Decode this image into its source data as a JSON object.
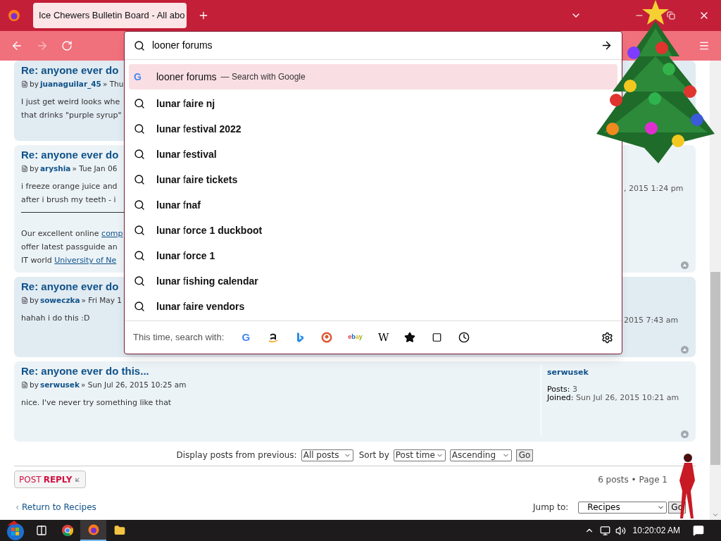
{
  "browser": {
    "tabs": [
      {
        "title": "Ice Chewers Bulletin Board - All abo",
        "selected": true
      }
    ],
    "address": {
      "value": "looner forums"
    },
    "suggestions": [
      {
        "kind": "engine",
        "glyph": "G",
        "text": "looner forums",
        "hint": "— Search with Google",
        "selected": true
      },
      {
        "kind": "search",
        "text": "**lunar** f**aire nj**",
        "selected": false
      },
      {
        "kind": "search",
        "text": "**lunar** f**estival 2022**",
        "selected": false
      },
      {
        "kind": "search",
        "text": "**lunar** f**estival**",
        "selected": false
      },
      {
        "kind": "search",
        "text": "**lunar** f**aire tickets**",
        "selected": false
      },
      {
        "kind": "search",
        "text": "**lunar** f**naf**",
        "selected": false
      },
      {
        "kind": "search",
        "text": "**lunar** f**orce 1 duckboot**",
        "selected": false
      },
      {
        "kind": "search",
        "text": "**lunar** f**orce 1**",
        "selected": false
      },
      {
        "kind": "search",
        "text": "**lunar** f**ishing calendar**",
        "selected": false
      },
      {
        "kind": "search",
        "text": "**lunar** f**aire vendors**",
        "selected": false
      }
    ],
    "search_with": {
      "label": "This time, search with:",
      "engines": [
        {
          "kind": "google",
          "glyph": "G"
        },
        {
          "kind": "amazon"
        },
        {
          "kind": "bing"
        },
        {
          "kind": "duckduckgo"
        },
        {
          "kind": "ebay"
        },
        {
          "kind": "wikipedia",
          "glyph": "W"
        },
        {
          "kind": "bookmarks"
        },
        {
          "kind": "tabs"
        },
        {
          "kind": "history"
        }
      ]
    }
  },
  "posts": [
    {
      "title": "Re: anyone ever do",
      "by": "by",
      "author": "juanaguilar_45",
      "meta": "» Thu",
      "body": [
        "I just get weird looks whe",
        "that drinks \"purple syrup\""
      ]
    },
    {
      "title": "Re: anyone ever do",
      "by": "by",
      "author": "aryshia",
      "meta": "» Tue Jan 06",
      "body": [
        "i freeze orange juice and",
        "after i brush my teeth - i"
      ],
      "signature": [
        {
          "text": "Our excellent online",
          "link": "comp"
        },
        {
          "text": "offer latest passguide an"
        },
        {
          "text": "IT world",
          "link": "University of Ne"
        }
      ],
      "right_text": ", 2015 1:24 pm"
    },
    {
      "title": "Re: anyone ever do",
      "by": "by",
      "author": "soweczka",
      "meta": "» Fri May 1",
      "body": [
        "hahah i do this :D"
      ],
      "right_text": "2015 7:43 am"
    },
    {
      "title": "Re: anyone ever do this...",
      "by": "by",
      "author": "serwusek",
      "meta": "» Sun Jul 26, 2015 10:25 am",
      "body": [
        "nice. I've never try something like that"
      ],
      "profile": {
        "name": "serwusek",
        "posts_label": "Posts:",
        "posts": "3",
        "joined_label": "Joined:",
        "joined": "Sun Jul 26, 2015 10:21 am"
      }
    }
  ],
  "sort_bar": {
    "label": "Display posts from previous:",
    "range": "All posts",
    "sort_label": "Sort by",
    "sort": "Post time",
    "order": "Ascending",
    "go": "Go"
  },
  "post_reply": {
    "post": "POST",
    "reply": "REPLY"
  },
  "pagination": "6 posts • Page 1",
  "return_link": "Return to Recipes",
  "jump": {
    "label": "Jump to:",
    "value": "Recipes",
    "go": "Go"
  },
  "taskbar": {
    "apps": [
      {
        "kind": "taskview",
        "active": false
      },
      {
        "kind": "chrome",
        "active": false
      },
      {
        "kind": "firefox",
        "active": true
      },
      {
        "kind": "explorer",
        "active": false
      }
    ],
    "clock": "10:20:02 AM"
  }
}
